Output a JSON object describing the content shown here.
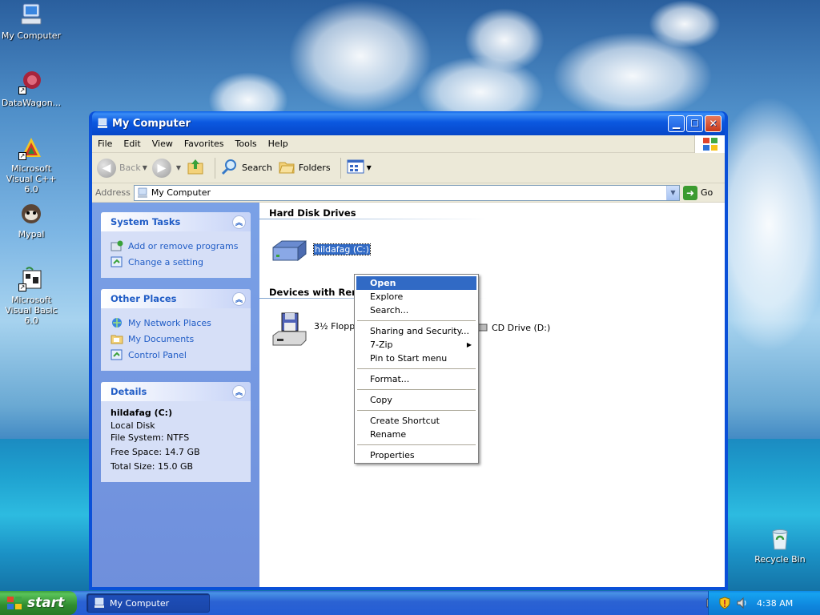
{
  "desktop": {
    "icons": [
      {
        "label": "My Computer"
      },
      {
        "label": "DataWagon..."
      },
      {
        "label": "Microsoft Visual C++ 6.0"
      },
      {
        "label": "Mypal"
      },
      {
        "label": "Microsoft Visual Basic 6.0"
      },
      {
        "label": "Recycle Bin"
      }
    ]
  },
  "window": {
    "title": "My Computer",
    "menu": [
      "File",
      "Edit",
      "View",
      "Favorites",
      "Tools",
      "Help"
    ],
    "toolbar": {
      "back": "Back",
      "search": "Search",
      "folders": "Folders"
    },
    "address": {
      "label": "Address",
      "value": "My Computer",
      "go": "Go"
    }
  },
  "left_pane": {
    "system_tasks": {
      "title": "System Tasks",
      "items": [
        "Add or remove programs",
        "Change a setting"
      ]
    },
    "other_places": {
      "title": "Other Places",
      "items": [
        "My Network Places",
        "My Documents",
        "Control Panel"
      ]
    },
    "details": {
      "title": "Details",
      "name": "hildafag (C:)",
      "type": "Local Disk",
      "file_system": "File System: NTFS",
      "free_space": "Free Space: 14.7 GB",
      "total_size": "Total Size: 15.0 GB"
    }
  },
  "content": {
    "hard_disk_title": "Hard Disk Drives",
    "removable_title": "Devices with Remo",
    "drives": {
      "c": "hildafag (C:)",
      "floppy": "3½ Floppy",
      "cd": "CD Drive (D:)"
    }
  },
  "context_menu": {
    "items": [
      {
        "label": "Open"
      },
      {
        "label": "Explore"
      },
      {
        "label": "Search..."
      },
      {
        "label": "Sharing and Security..."
      },
      {
        "label": "7-Zip"
      },
      {
        "label": "Pin to Start menu"
      },
      {
        "label": "Format..."
      },
      {
        "label": "Copy"
      },
      {
        "label": "Create Shortcut"
      },
      {
        "label": "Rename"
      },
      {
        "label": "Properties"
      }
    ]
  },
  "taskbar": {
    "start": "start",
    "task": "My Computer",
    "clock": "4:38 AM"
  },
  "colors": {
    "titlebar": "#0a5fe8",
    "selection": "#316ac5",
    "task_link": "#215dc6",
    "start_green": "#3c9f3c"
  },
  "icons": [
    "my-computer-icon",
    "datawagon-icon",
    "vc6-icon",
    "mypal-icon",
    "vb6-icon",
    "recycle-bin-icon",
    "hard-disk-icon",
    "floppy-icon",
    "cd-drive-icon"
  ]
}
